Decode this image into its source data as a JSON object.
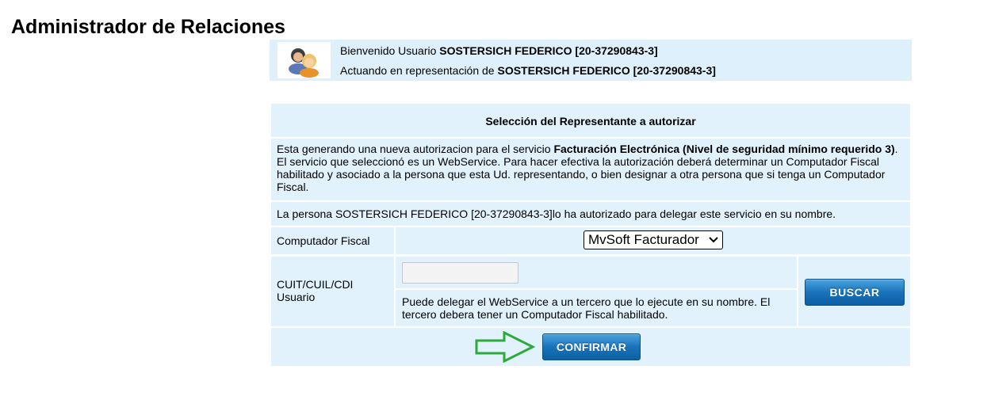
{
  "page": {
    "title": "Administrador de Relaciones"
  },
  "welcome": {
    "line1_prefix": "Bienvenido Usuario ",
    "line1_user": "SOSTERSICH FEDERICO [20-37290843-3]",
    "line2_prefix": "Actuando en representación de ",
    "line2_user": "SOSTERSICH FEDERICO [20-37290843-3]",
    "avatar_icon": "users-icon"
  },
  "panel": {
    "header": "Selección del Representante a autorizar",
    "intro": {
      "text1": "Esta generando una nueva autorizacion para el servicio ",
      "service": "Facturación Electrónica (Nivel de seguridad mínimo requerido 3)",
      "text2": ". El servicio que seleccionó es un WebService. Para hacer efectiva la autorización deberá determinar un Computador Fiscal habilitado y asociado a la persona que esta Ud. representando, o bien designar a otra persona que si tenga un Computador Fiscal."
    },
    "delegated": "La persona SOSTERSICH FEDERICO [20-37290843-3]lo ha autorizado para delegar este servicio en su nombre.",
    "computador_fiscal": {
      "label": "Computador Fiscal",
      "selected": "MvSoft Facturador",
      "chevron": "⌄"
    },
    "cuit": {
      "label": "CUIT/CUIL/CDI Usuario",
      "value": "",
      "help": "Puede delegar el WebService a un tercero que lo ejecute en su nombre. El tercero debera tener un Computador Fiscal habilitado."
    },
    "buttons": {
      "buscar": "BUSCAR",
      "confirmar": "CONFIRMAR"
    },
    "annotation_arrow_icon": "green-arrow-icon"
  },
  "colors": {
    "panel_bg": "#e1f2fc",
    "button_blue": "#1a73ba",
    "arrow_green": "#2eaa3c"
  }
}
